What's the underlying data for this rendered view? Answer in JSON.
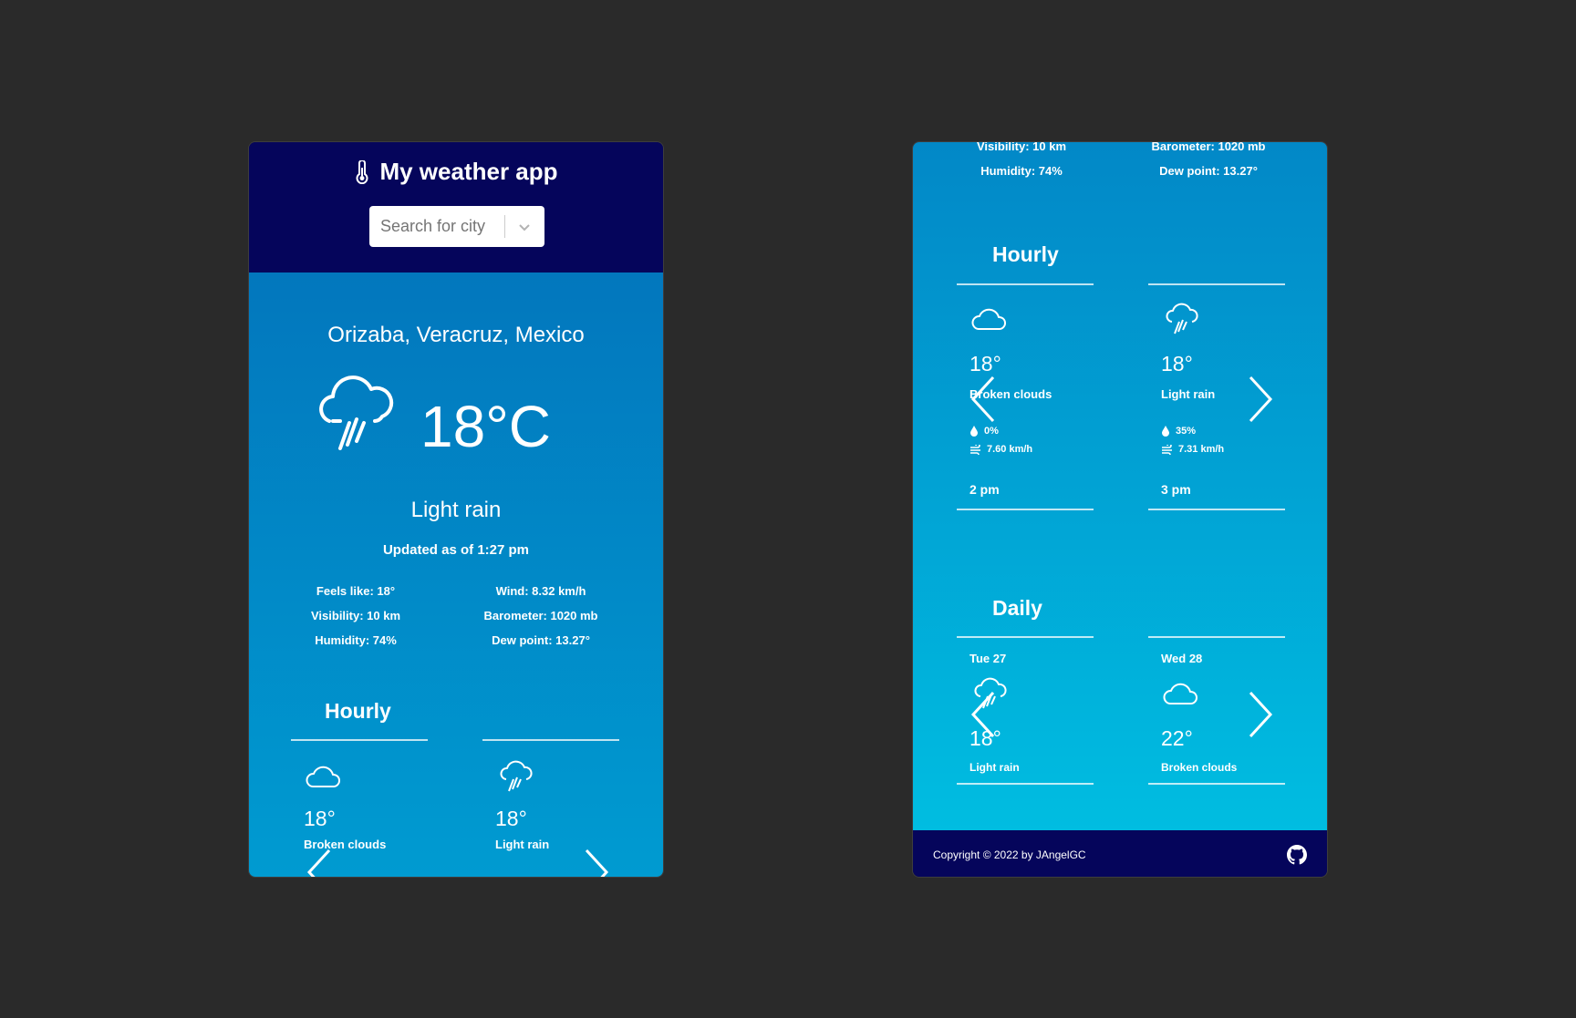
{
  "header": {
    "title": "My weather app"
  },
  "search": {
    "placeholder": "Search for city"
  },
  "current": {
    "city": "Orizaba, Veracruz, Mexico",
    "temp": "18°C",
    "condition": "Light rain",
    "updated": "Updated as of 1:27 pm",
    "details_left": [
      "Feels like: 18°",
      "Visibility: 10 km",
      "Humidity: 74%"
    ],
    "details_right": [
      "Wind: 8.32 km/h",
      "Barometer: 1020 mb",
      "Dew point: 13.27°"
    ]
  },
  "right_top": {
    "left_cut": "Visibility: 10 km",
    "left": "Humidity: 74%",
    "right_cut": "Barometer: 1020 mb",
    "right": "Dew point: 13.27°"
  },
  "hourly": {
    "title": "Hourly",
    "items": [
      {
        "icon": "cloud-icon",
        "temp": "18°",
        "condition": "Broken clouds",
        "precip": "0%",
        "wind": "7.60 km/h",
        "time": "2 pm"
      },
      {
        "icon": "rain-icon",
        "temp": "18°",
        "condition": "Light rain",
        "precip": "35%",
        "wind": "7.31 km/h",
        "time": "3 pm"
      }
    ]
  },
  "daily": {
    "title": "Daily",
    "items": [
      {
        "day": "Tue 27",
        "icon": "rain-icon",
        "temp": "18°",
        "condition": "Light rain"
      },
      {
        "day": "Wed 28",
        "icon": "cloud-icon",
        "temp": "22°",
        "condition": "Broken clouds"
      }
    ]
  },
  "footer": {
    "copyright": "Copyright © 2022 by JAngelGC",
    "icon": "github-icon"
  },
  "colors": {
    "header": "#05055b",
    "gradient_top": "#0277bd",
    "gradient_bottom": "#00bde1",
    "background": "#2a2a2a"
  }
}
